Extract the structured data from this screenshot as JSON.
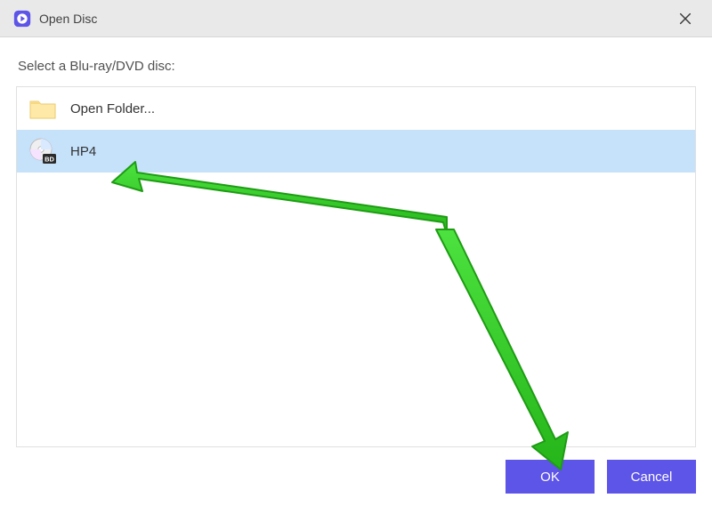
{
  "titlebar": {
    "title": "Open Disc"
  },
  "body": {
    "prompt": "Select a Blu-ray/DVD disc:",
    "items": [
      {
        "icon": "folder-icon",
        "label": "Open Folder...",
        "selected": false
      },
      {
        "icon": "bd-disc-icon",
        "label": "HP4",
        "selected": true
      }
    ]
  },
  "buttons": {
    "ok": "OK",
    "cancel": "Cancel"
  },
  "colors": {
    "accent": "#5d54e8",
    "selection": "#c6e2fb",
    "arrow": "#35c428",
    "arrow_stroke": "#1e9c14"
  }
}
